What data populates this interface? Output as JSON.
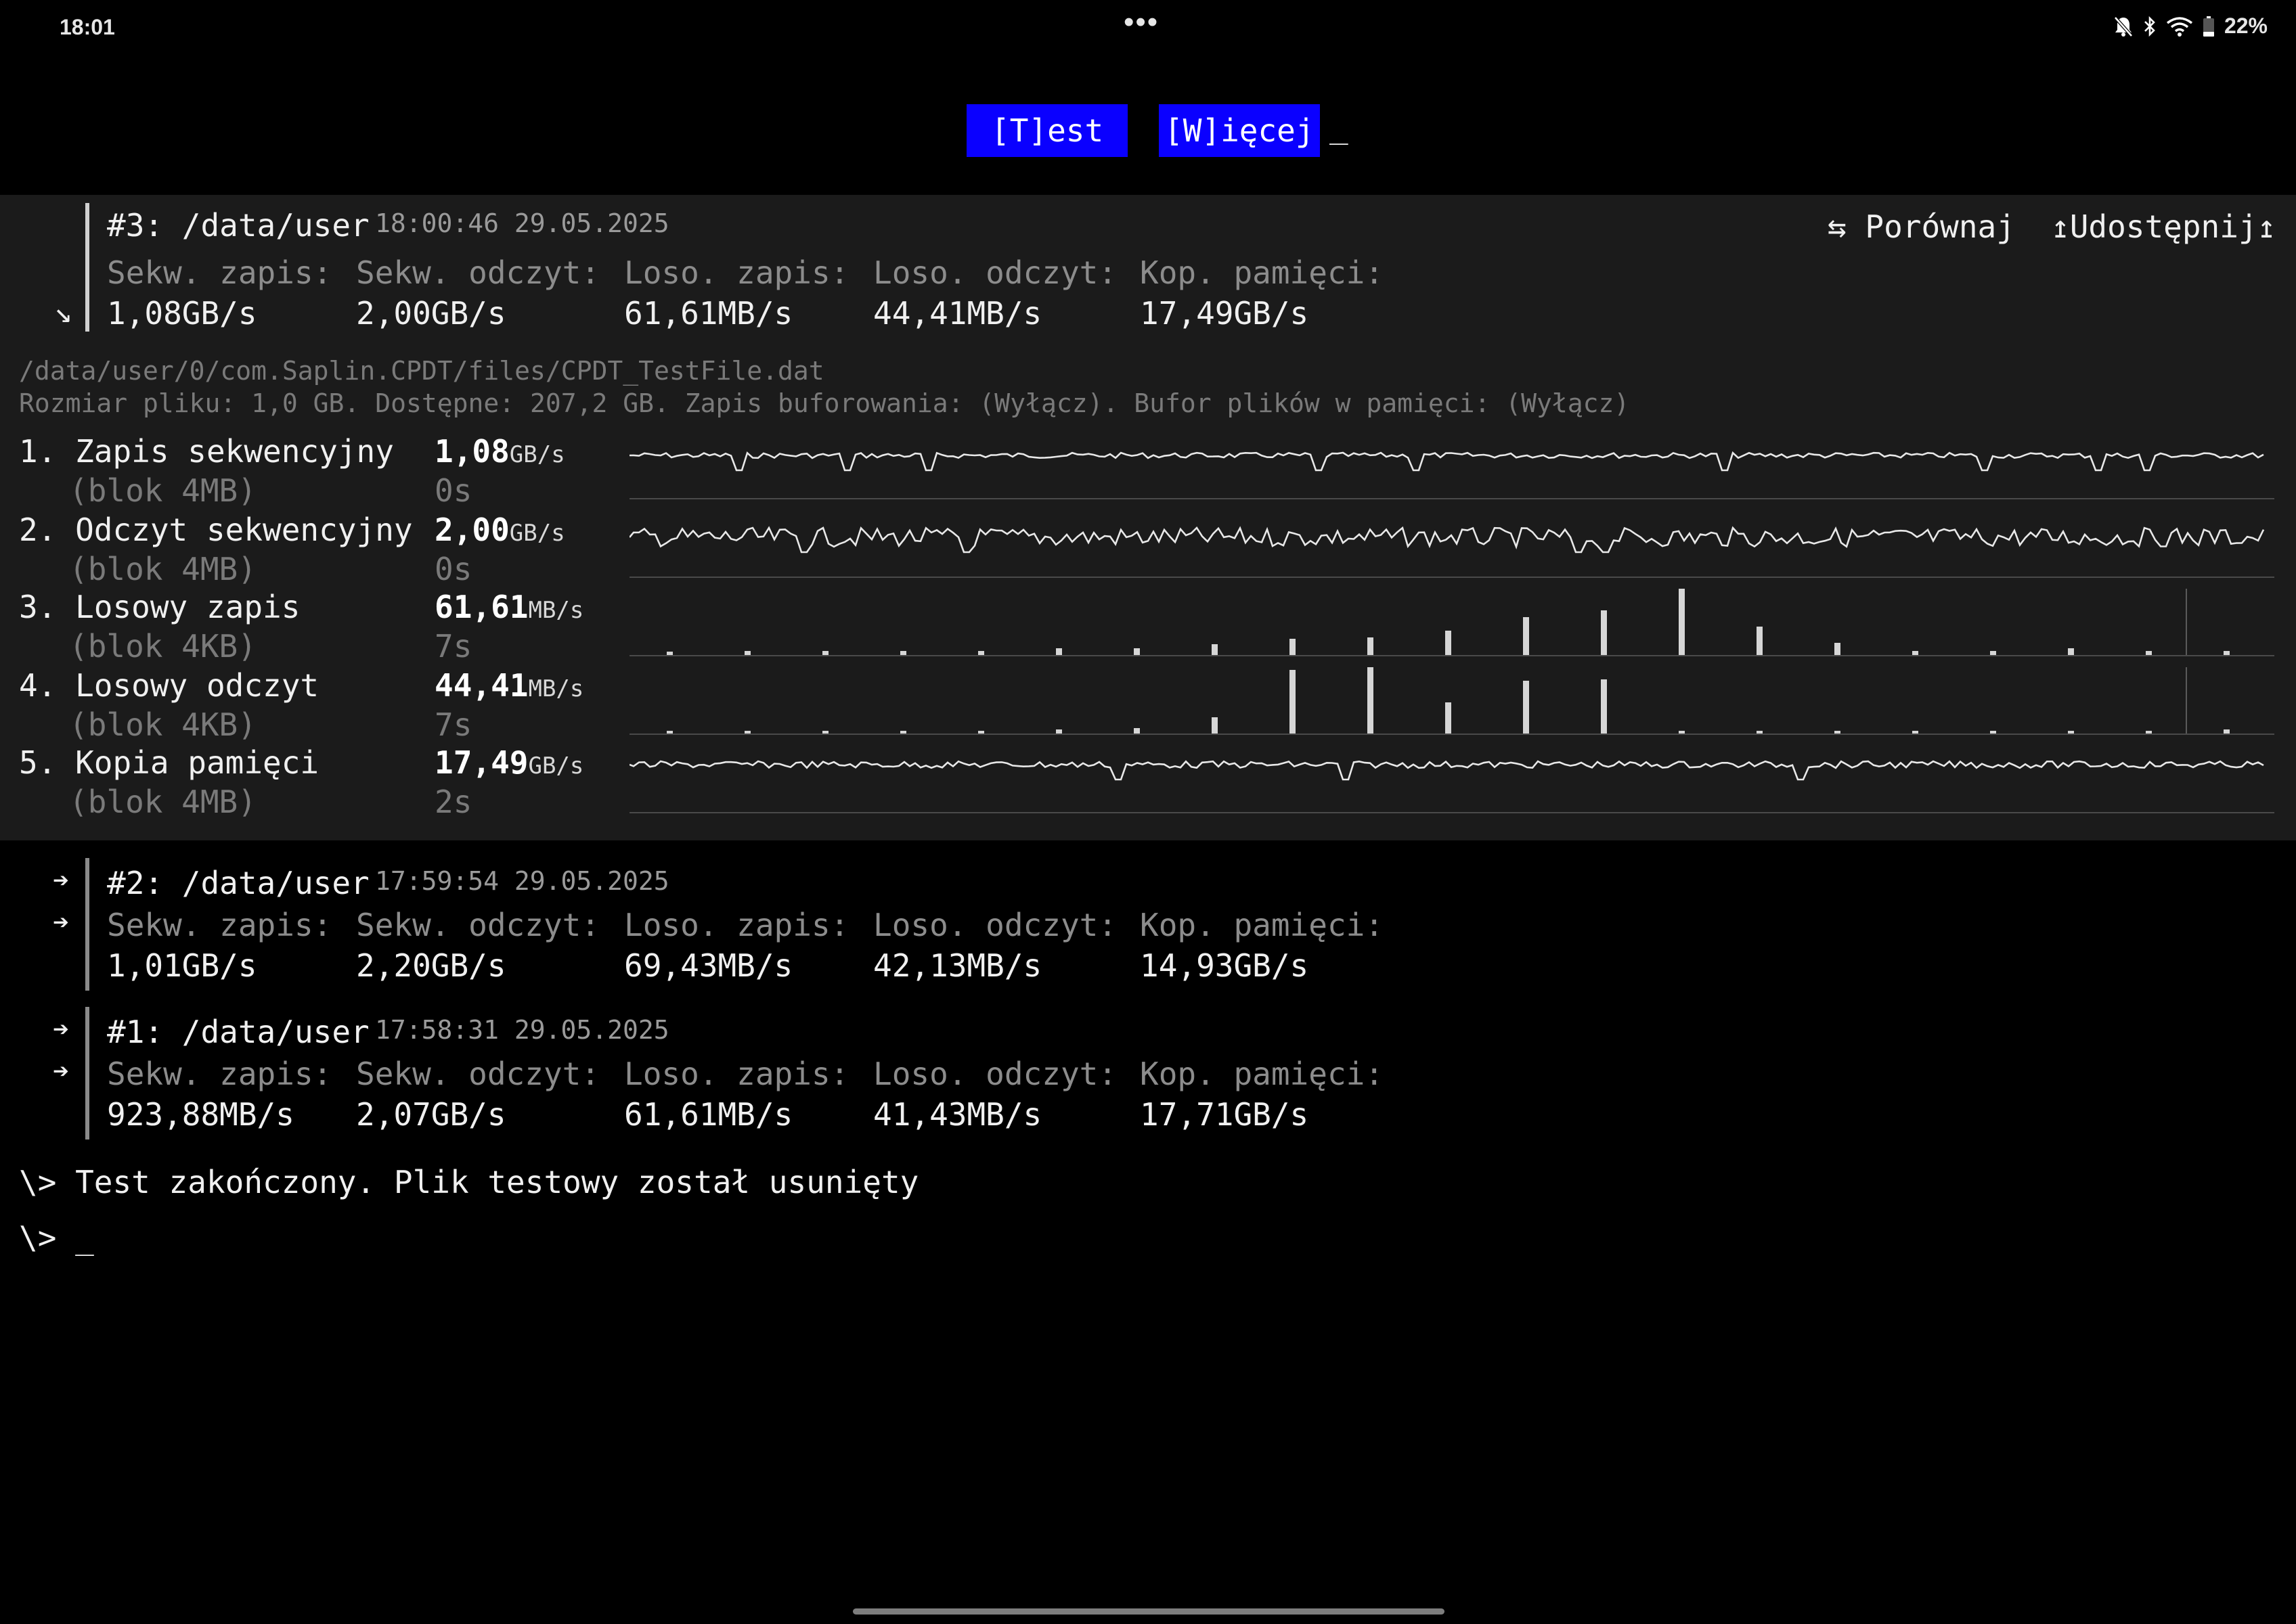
{
  "status_bar": {
    "time": "18:01",
    "dots": "•••",
    "battery": "22%"
  },
  "toolbar": {
    "test_label": "[T]est",
    "more_label": "[W]ięcej",
    "cursor": "_"
  },
  "current": {
    "title": "#3: /data/user",
    "timestamp": "18:00:46 29.05.2025",
    "compare_label": "⇆ Porównaj",
    "share_label": "↥Udostępnij↥",
    "collapse_arrow": "↘",
    "headers": [
      "Sekw. zapis:",
      "Sekw. odczyt:",
      "Loso. zapis:",
      "Loso. odczyt:",
      "Kop. pamięci:"
    ],
    "values": [
      "1,08GB/s",
      "2,00GB/s",
      "61,61MB/s",
      "44,41MB/s",
      "17,49GB/s"
    ],
    "file_path": "/data/user/0/com.Saplin.CPDT/files/CPDT_TestFile.dat",
    "file_info": "Rozmiar pliku: 1,0 GB. Dostępne: 207,2 GB. Zapis buforowania: (Wyłącz). Bufor plików w pamięci: (Wyłącz)",
    "tests": [
      {
        "name": "1. Zapis sekwencyjny",
        "block": "(blok 4MB)",
        "value": "1,08",
        "unit": "GB/s",
        "time": "0s"
      },
      {
        "name": "2. Odczyt sekwencyjny",
        "block": "(blok 4MB)",
        "value": "2,00",
        "unit": "GB/s",
        "time": "0s"
      },
      {
        "name": "3. Losowy zapis",
        "block": "(blok 4KB)",
        "value": "61,61",
        "unit": "MB/s",
        "time": "7s"
      },
      {
        "name": "4. Losowy odczyt",
        "block": "(blok 4KB)",
        "value": "44,41",
        "unit": "MB/s",
        "time": "7s"
      },
      {
        "name": "5. Kopia pamięci",
        "block": "(blok 4MB)",
        "value": "17,49",
        "unit": "GB/s",
        "time": "2s"
      }
    ]
  },
  "history": [
    {
      "title": "#2: /data/user",
      "timestamp": "17:59:54 29.05.2025",
      "arrow": "➔",
      "headers": [
        "Sekw. zapis:",
        "Sekw. odczyt:",
        "Loso. zapis:",
        "Loso. odczyt:",
        "Kop. pamięci:"
      ],
      "values": [
        "1,01GB/s",
        "2,20GB/s",
        "69,43MB/s",
        "42,13MB/s",
        "14,93GB/s"
      ]
    },
    {
      "title": "#1: /data/user",
      "timestamp": "17:58:31 29.05.2025",
      "arrow": "➔",
      "headers": [
        "Sekw. zapis:",
        "Sekw. odczyt:",
        "Loso. zapis:",
        "Loso. odczyt:",
        "Kop. pamięci:"
      ],
      "values": [
        "923,88MB/s",
        "2,07GB/s",
        "61,61MB/s",
        "41,43MB/s",
        "17,71GB/s"
      ]
    }
  ],
  "console": {
    "message": "\\> Test zakończony. Plik testowy został usunięty",
    "prompt": "\\> _"
  }
}
